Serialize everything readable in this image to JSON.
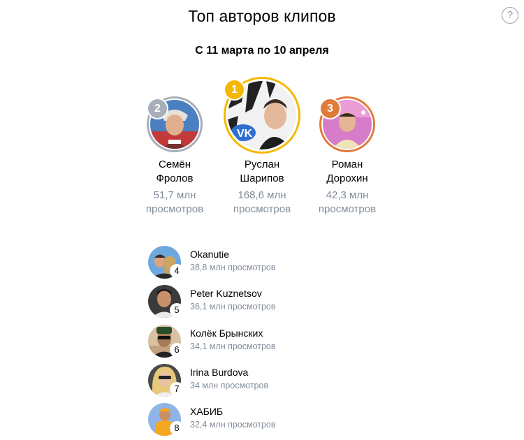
{
  "header": {
    "title": "Топ авторов клипов",
    "help_icon": "question-circle-icon",
    "help_glyph": "?"
  },
  "period": "С 11 марта по 10 апреля",
  "podium": [
    {
      "rank": "2",
      "name_line1": "Семён",
      "name_line2": "Фролов",
      "views_line1": "51,7 млн",
      "views_line2": "просмотров",
      "rank_color": "#a8afb8",
      "ring_color": "#a8afb8"
    },
    {
      "rank": "1",
      "name_line1": "Руслан",
      "name_line2": "Шарипов",
      "views_line1": "168,6 млн",
      "views_line2": "просмотров",
      "rank_color": "#f5b800",
      "ring_color": "#f5b800"
    },
    {
      "rank": "3",
      "name_line1": "Роман",
      "name_line2": "Дорохин",
      "views_line1": "42,3 млн",
      "views_line2": "просмотров",
      "rank_color": "#e07b39",
      "ring_color": "#e07b39"
    }
  ],
  "list": [
    {
      "rank": "4",
      "name": "Okanutie",
      "views": "38,8 млн просмотров"
    },
    {
      "rank": "5",
      "name": "Peter Kuznetsov",
      "views": "36,1 млн просмотров"
    },
    {
      "rank": "6",
      "name": "Колёк Брынских",
      "views": "34,1 млн просмотров"
    },
    {
      "rank": "7",
      "name": "Irina Burdova",
      "views": "34 млн просмотров"
    },
    {
      "rank": "8",
      "name": "ХАБИБ",
      "views": "32,4 млн просмотров"
    }
  ]
}
